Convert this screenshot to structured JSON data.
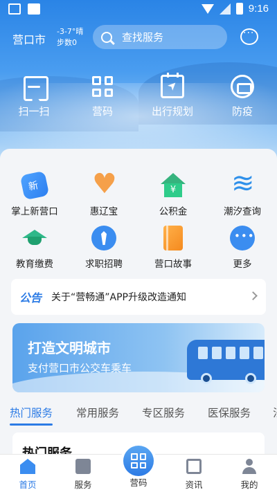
{
  "status_bar": {
    "time": "9:16"
  },
  "header": {
    "city": "营口市",
    "weather_line1": "-3-7°晴",
    "weather_line2": "步数0",
    "search_placeholder": "查找服务"
  },
  "quick_actions": [
    {
      "label": "扫一扫",
      "icon": "scan-icon"
    },
    {
      "label": "营码",
      "icon": "qr-code-icon"
    },
    {
      "label": "出行规划",
      "icon": "travel-plan-icon"
    },
    {
      "label": "防疫",
      "icon": "epidemic-icon"
    }
  ],
  "service_grid": [
    {
      "label": "掌上新营口",
      "icon": "new-yingkou-icon"
    },
    {
      "label": "惠辽宝",
      "icon": "huiliaobao-icon"
    },
    {
      "label": "公积金",
      "icon": "housing-fund-icon"
    },
    {
      "label": "潮汐查询",
      "icon": "tide-icon"
    },
    {
      "label": "教育缴费",
      "icon": "education-icon"
    },
    {
      "label": "求职招聘",
      "icon": "job-icon"
    },
    {
      "label": "营口故事",
      "icon": "story-icon"
    },
    {
      "label": "更多",
      "icon": "more-icon"
    }
  ],
  "notice": {
    "tag": "公告",
    "text": "关于“营畅通”APP升级改造通知"
  },
  "banner": {
    "title": "打造文明城市",
    "subtitle": "支付营口市公交车乘车"
  },
  "tabs": [
    {
      "label": "热门服务",
      "active": true
    },
    {
      "label": "常用服务",
      "active": false
    },
    {
      "label": "专区服务",
      "active": false
    },
    {
      "label": "医保服务",
      "active": false
    },
    {
      "label": "法",
      "active": false
    }
  ],
  "hot_section": {
    "title": "热门服务"
  },
  "bottom_nav": [
    {
      "label": "首页",
      "active": true
    },
    {
      "label": "服务",
      "active": false
    },
    {
      "label": "营码",
      "active": false
    },
    {
      "label": "资讯",
      "active": false
    },
    {
      "label": "我的",
      "active": false
    }
  ],
  "colors": {
    "accent": "#2c7be5",
    "hero_top": "#2a84e6"
  }
}
